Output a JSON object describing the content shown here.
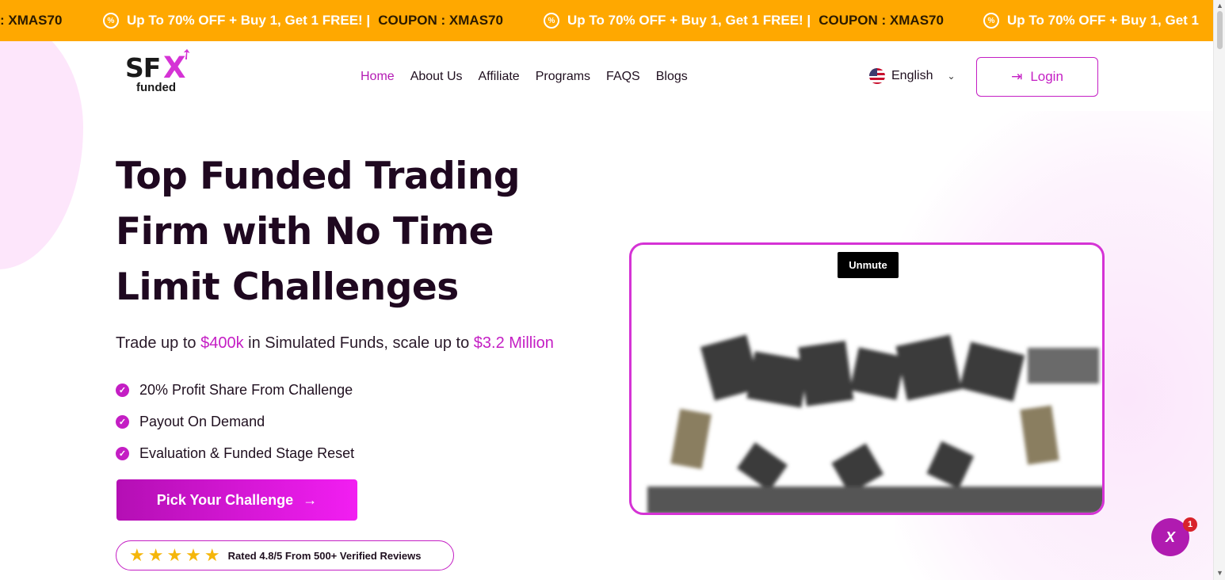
{
  "promo": {
    "fragment": ": XMAS70",
    "items": [
      {
        "text": "Up To 70% OFF + Buy 1, Get 1 FREE! |",
        "coupon": "COUPON : XMAS70"
      },
      {
        "text": "Up To 70% OFF + Buy 1, Get 1 FREE! |",
        "coupon": "COUPON : XMAS70"
      },
      {
        "text": "Up To 70% OFF + Buy 1, Get 1",
        "coupon": ""
      }
    ],
    "icon": "discount-badge-icon",
    "color": "#ffa800"
  },
  "brand": {
    "logo_main": "SF",
    "logo_x": "X",
    "logo_sub": "funded",
    "accent": "#c41ec4"
  },
  "nav": {
    "items": [
      {
        "label": "Home",
        "active": true
      },
      {
        "label": "About Us"
      },
      {
        "label": "Affiliate"
      },
      {
        "label": "Programs"
      },
      {
        "label": "FAQS"
      },
      {
        "label": "Blogs"
      }
    ]
  },
  "language": {
    "selected": "English",
    "flag_icon": "us-flag-icon"
  },
  "login": {
    "label": "Login",
    "icon": "login-arrow-icon"
  },
  "hero": {
    "title": "Top Funded Trading Firm with No Time Limit Challenges",
    "sub_prefix": "Trade up to ",
    "sub_amount1": "$400k",
    "sub_mid": " in Simulated Funds, scale up to ",
    "sub_amount2": "$3.2 Million",
    "features": [
      "20% Profit Share From Challenge",
      "Payout On Demand",
      "Evaluation & Funded Stage Reset"
    ],
    "cta_label": "Pick Your Challenge",
    "rating_stars": 5,
    "rating_text": "Rated 4.8/5 From 500+ Verified Reviews"
  },
  "video": {
    "unmute_label": "Unmute"
  },
  "chat": {
    "badge_count": "1",
    "icon": "chat-logo-icon"
  }
}
